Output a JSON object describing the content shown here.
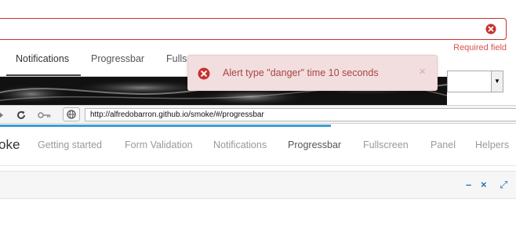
{
  "form": {
    "required_label": "Required field"
  },
  "tabs": [
    {
      "label": "Notifications"
    },
    {
      "label": "Progressbar"
    },
    {
      "label": "Fullscreen"
    }
  ],
  "alert": {
    "message": "Alert type \"danger\" time 10 seconds",
    "close": "×"
  },
  "browser": {
    "url": "http://alfredobarron.github.io/smoke/#/progressbar"
  },
  "navbar": {
    "brand": "oke",
    "items": [
      "Getting started",
      "Form Validation",
      "Notifications",
      "Progressbar",
      "Fullscreen",
      "Panel",
      "Helpers"
    ]
  },
  "panel": {
    "minimize": "–",
    "close": "×",
    "expand": "⤢"
  },
  "colors": {
    "danger": "#d9534f",
    "alert_bg": "#f2dede",
    "progress": "#3d9dd5",
    "panel_btn": "#2a6ebb"
  }
}
